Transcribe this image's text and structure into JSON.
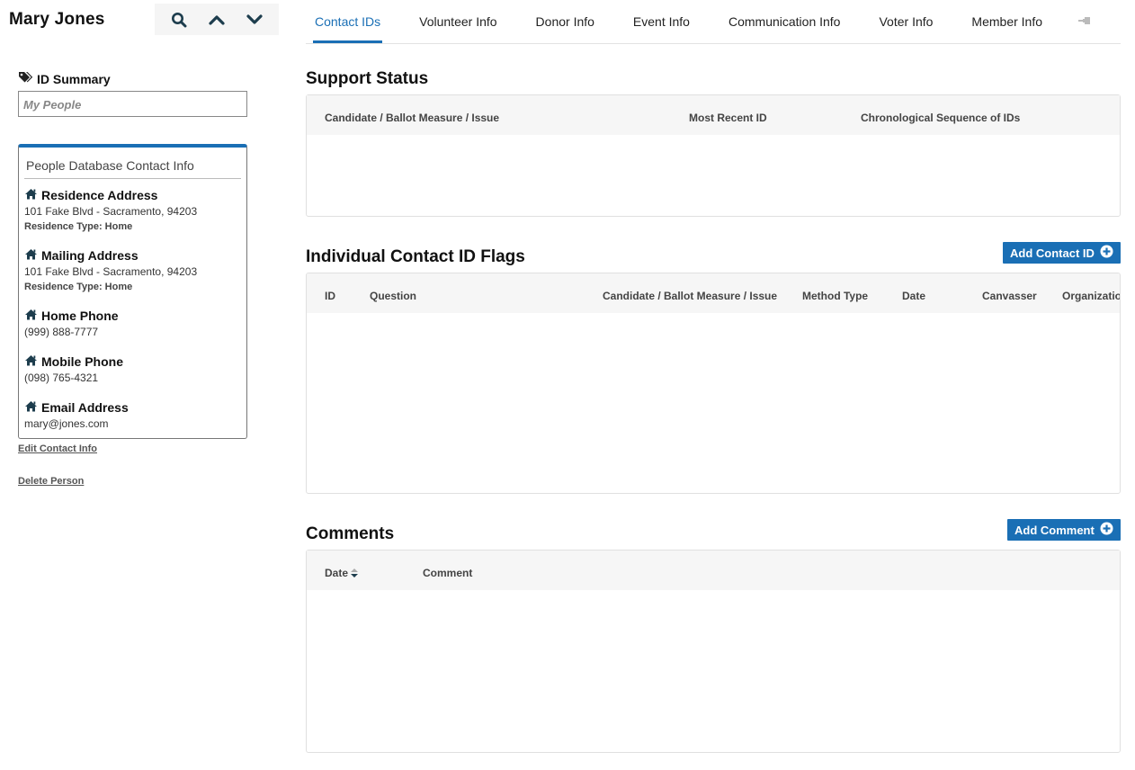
{
  "person": {
    "name": "Mary Jones"
  },
  "nav_tools": [
    "search-icon",
    "chevron-up-icon",
    "chevron-down-icon"
  ],
  "id_summary": {
    "label": "ID Summary",
    "dropdown_value": "My People"
  },
  "contact_card": {
    "title": "People Database Contact Info",
    "residence": {
      "label": "Residence Address",
      "line": "101 Fake Blvd - Sacramento, 94203",
      "type_label": "Residence Type: Home"
    },
    "mailing": {
      "label": "Mailing Address",
      "line": "101 Fake Blvd - Sacramento, 94203",
      "type_label": "Residence Type: Home"
    },
    "home_phone": {
      "label": "Home Phone",
      "value": "(999) 888-7777"
    },
    "mobile_phone": {
      "label": "Mobile Phone",
      "value": "(098) 765-4321"
    },
    "email": {
      "label": "Email Address",
      "value": "mary@jones.com"
    }
  },
  "links": {
    "edit_contact": "Edit Contact Info",
    "delete_person": "Delete Person"
  },
  "tabs": [
    {
      "label": "Contact IDs",
      "active": true
    },
    {
      "label": "Volunteer Info"
    },
    {
      "label": "Donor Info"
    },
    {
      "label": "Event Info"
    },
    {
      "label": "Communication Info"
    },
    {
      "label": "Voter Info"
    },
    {
      "label": "Member Info"
    }
  ],
  "support_status": {
    "title": "Support Status",
    "columns": [
      "Candidate / Ballot Measure / Issue",
      "Most Recent ID",
      "Chronological Sequence of IDs"
    ]
  },
  "contact_flags": {
    "title": "Individual Contact ID Flags",
    "add_label": "Add Contact ID",
    "columns": [
      "ID",
      "Question",
      "Candidate / Ballot Measure / Issue",
      "Method Type",
      "Date",
      "Canvasser",
      "Organization"
    ]
  },
  "comments": {
    "title": "Comments",
    "add_label": "Add Comment",
    "columns": [
      "Date",
      "Comment"
    ]
  },
  "colors": {
    "accent": "#1a6fb5",
    "icon_dark": "#1d3d4d"
  }
}
